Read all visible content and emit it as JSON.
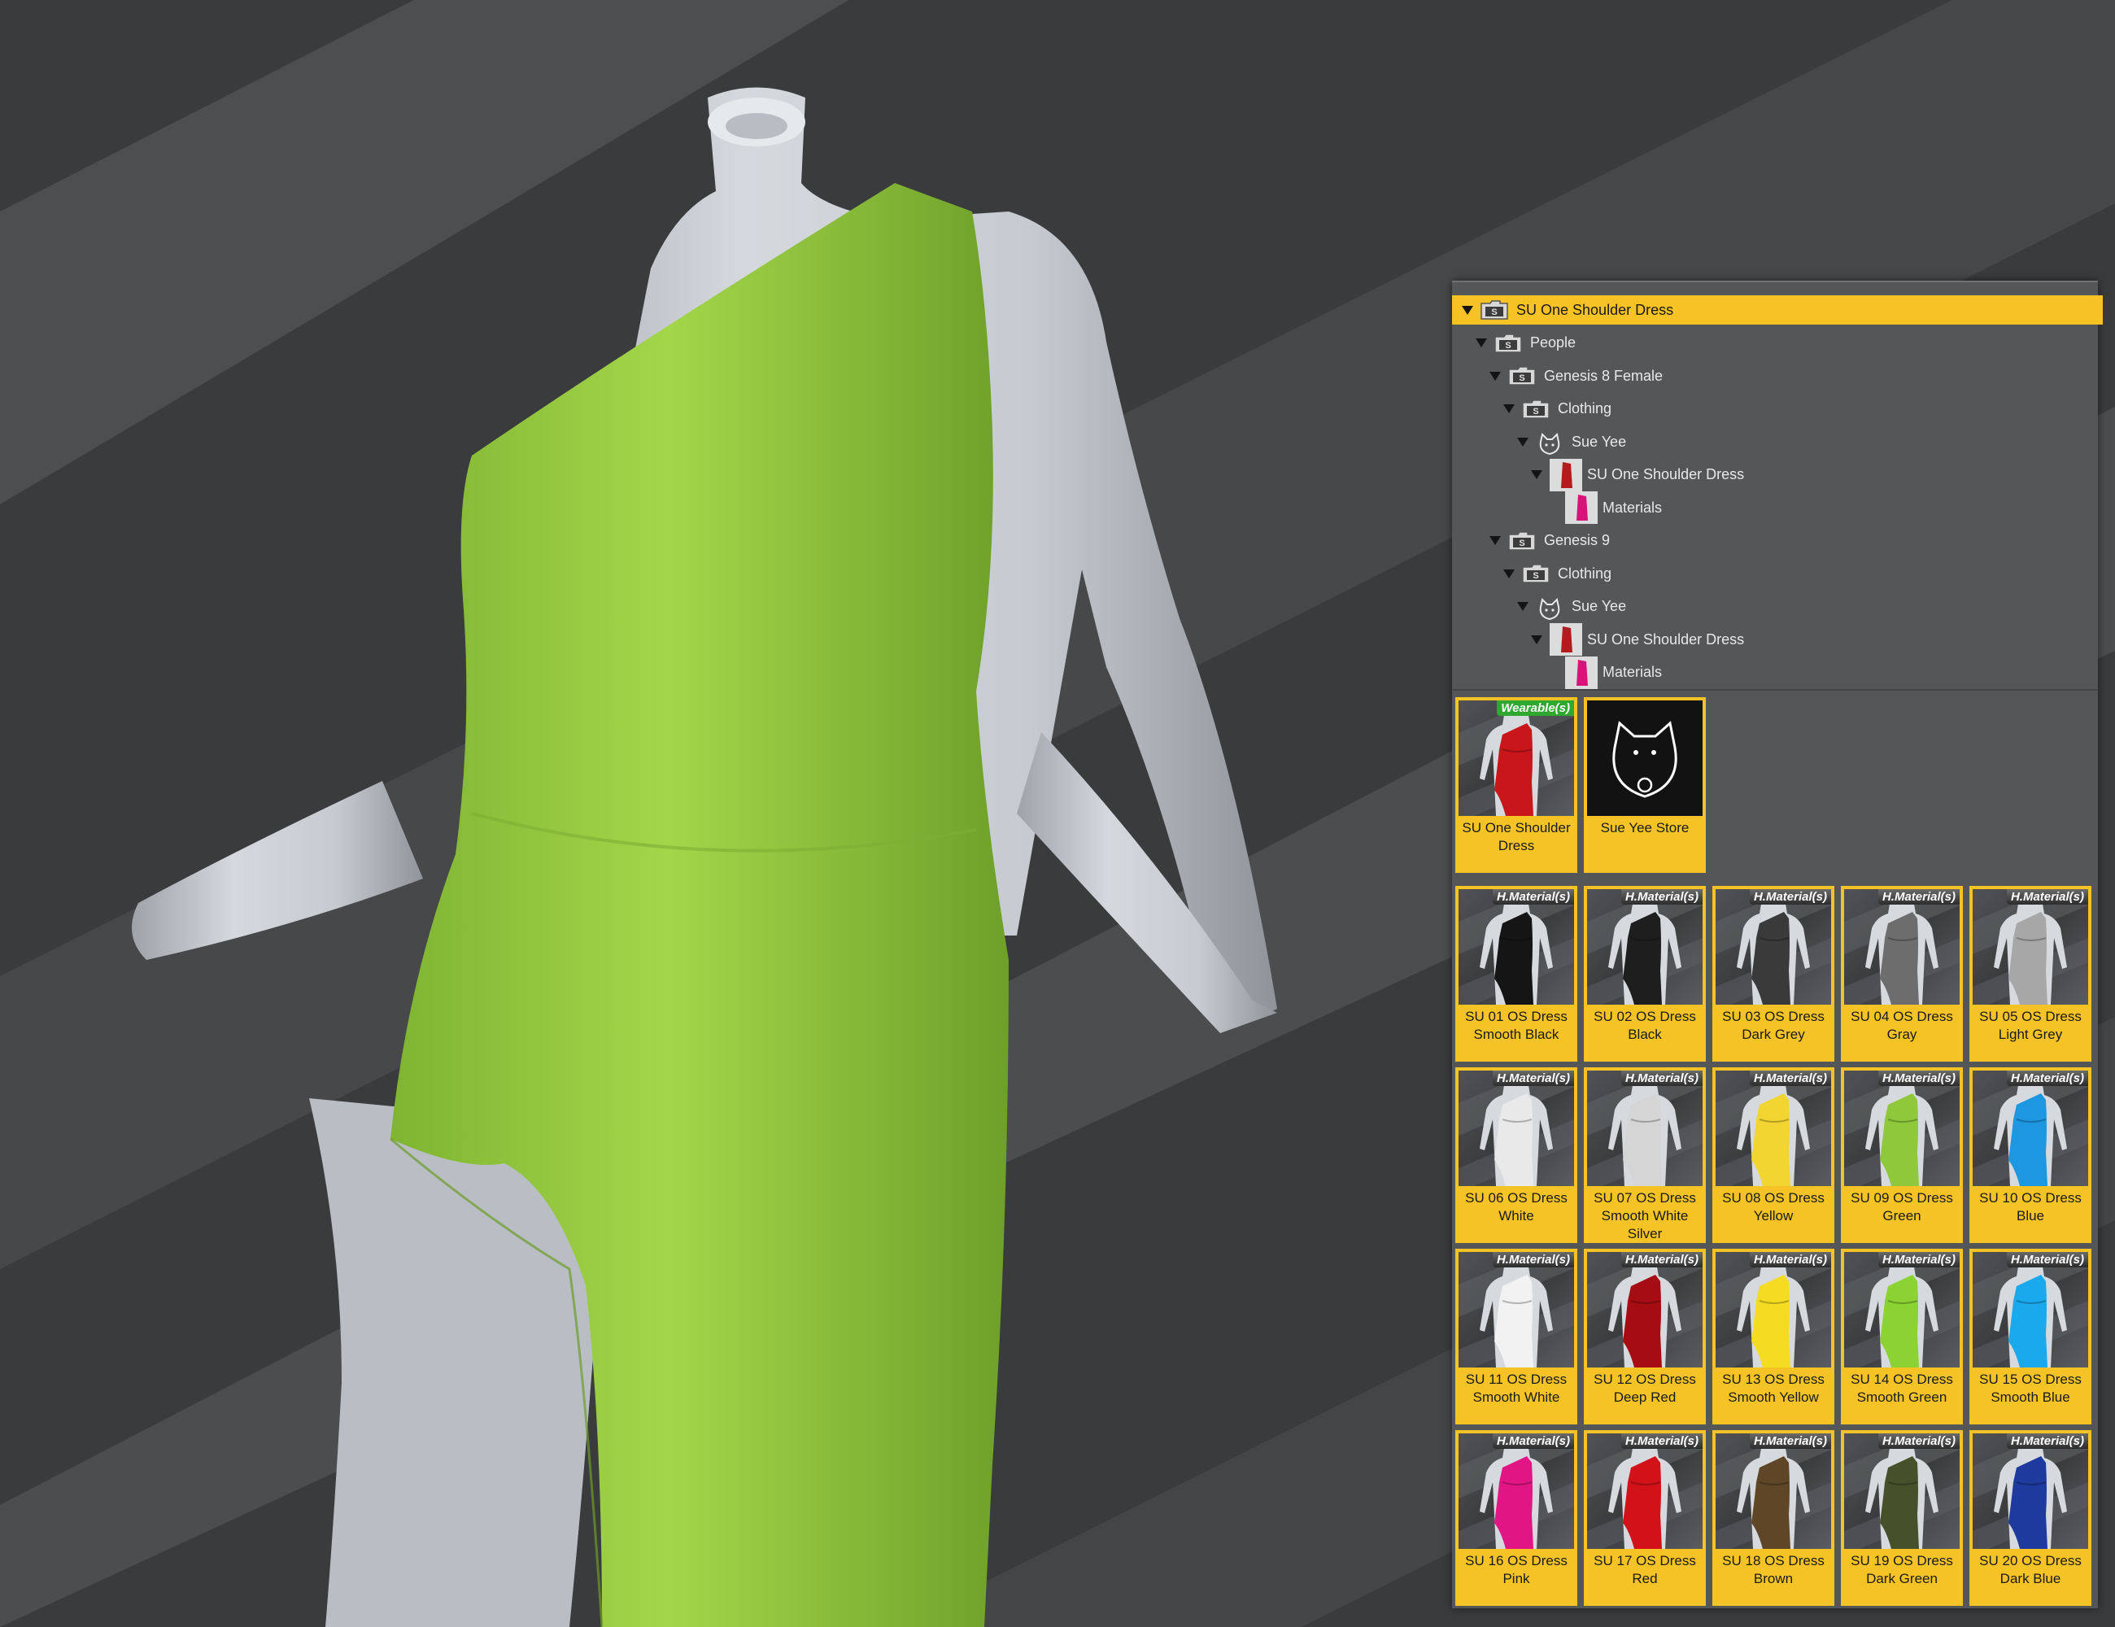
{
  "tree": [
    {
      "label": "SU One Shoulder Dress",
      "depth": 0,
      "icon": "folder-icon",
      "selected": true
    },
    {
      "label": "People",
      "depth": 1,
      "icon": "folder-icon"
    },
    {
      "label": "Genesis 8 Female",
      "depth": 2,
      "icon": "folder-icon"
    },
    {
      "label": "Clothing",
      "depth": 3,
      "icon": "folder-icon"
    },
    {
      "label": "Sue Yee",
      "depth": 4,
      "icon": "vendor-logo-icon"
    },
    {
      "label": "SU One Shoulder Dress",
      "depth": 5,
      "icon": "dress-thumbnail-icon"
    },
    {
      "label": "Materials",
      "depth": 6,
      "icon": "materials-thumbnail-icon",
      "leaf": true
    },
    {
      "label": "Genesis 9",
      "depth": 2,
      "icon": "folder-icon"
    },
    {
      "label": "Clothing",
      "depth": 3,
      "icon": "folder-icon"
    },
    {
      "label": "Sue Yee",
      "depth": 4,
      "icon": "vendor-logo-icon"
    },
    {
      "label": "SU One Shoulder Dress",
      "depth": 5,
      "icon": "dress-thumbnail-icon"
    },
    {
      "label": "Materials",
      "depth": 6,
      "icon": "materials-thumbnail-icon",
      "leaf": true
    }
  ],
  "top_tiles": [
    {
      "caption": "SU One Shoulder Dress",
      "badge": "Wearable(s)",
      "kind": "wearable",
      "color": "#c8161a"
    },
    {
      "caption": "Sue Yee Store",
      "badge": "",
      "kind": "store",
      "logo_text": "sueyee"
    }
  ],
  "material_badge": "H.Material(s)",
  "materials": [
    {
      "caption": "SU 01 OS Dress Smooth Black",
      "color": "#151515"
    },
    {
      "caption": "SU 02 OS Dress Black",
      "color": "#1e1e1e"
    },
    {
      "caption": "SU 03 OS Dress Dark Grey",
      "color": "#3a3a3a"
    },
    {
      "caption": "SU 04 OS Dress Gray",
      "color": "#6d6d6d"
    },
    {
      "caption": "SU 05 OS Dress Light Grey",
      "color": "#a7a7a7"
    },
    {
      "caption": "SU 06 OS Dress White",
      "color": "#e9e9e9"
    },
    {
      "caption": "SU 07 OS Dress Smooth White Silver",
      "color": "#d5d5d5"
    },
    {
      "caption": "SU 08 OS Dress Yellow",
      "color": "#f2d531"
    },
    {
      "caption": "SU 09 OS Dress Green",
      "color": "#8fc83a"
    },
    {
      "caption": "SU 10 OS Dress Blue",
      "color": "#1d97df"
    },
    {
      "caption": "SU 11 OS Dress Smooth White",
      "color": "#f2f2f2"
    },
    {
      "caption": "SU 12 OS Dress Deep Red",
      "color": "#a60d12"
    },
    {
      "caption": "SU 13 OS Dress Smooth Yellow",
      "color": "#f5dc22"
    },
    {
      "caption": "SU 14 OS Dress Smooth Green",
      "color": "#8bd233"
    },
    {
      "caption": "SU 15 OS Dress Smooth Blue",
      "color": "#1aa9ec"
    },
    {
      "caption": "SU 16 OS Dress Pink",
      "color": "#e21585"
    },
    {
      "caption": "SU 17 OS Dress Red",
      "color": "#d21218"
    },
    {
      "caption": "SU 18 OS Dress Brown",
      "color": "#5e4627"
    },
    {
      "caption": "SU 19 OS Dress Dark Green",
      "color": "#45512a"
    },
    {
      "caption": "SU 20 OS Dress Dark Blue",
      "color": "#1e3a9e"
    }
  ],
  "colors": {
    "accent": "#f5c326",
    "dress": "#96cd3e",
    "mannequin": "#c6cbd1",
    "panel": "#555657"
  }
}
